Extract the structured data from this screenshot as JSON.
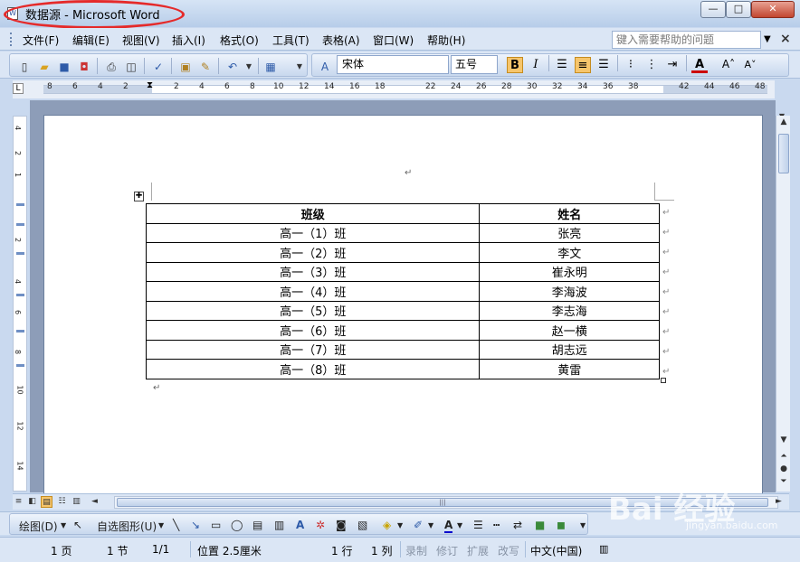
{
  "window": {
    "title": "数据源 - Microsoft Word",
    "min_glyph": "—",
    "max_glyph": "□",
    "close_glyph": "✕"
  },
  "menubar": {
    "items": [
      "文件(F)",
      "编辑(E)",
      "视图(V)",
      "插入(I)",
      "格式(O)",
      "工具(T)",
      "表格(A)",
      "窗口(W)",
      "帮助(H)"
    ],
    "help_placeholder": "键入需要帮助的问题",
    "close_doc": "×"
  },
  "toolbar": {
    "font_name": "宋体",
    "font_size": "五号",
    "bold_label": "B",
    "italic_label": "I",
    "font_color_label": "A",
    "grow_label": "A˄",
    "shrink_label": "A˅",
    "accent": "#f6c56b"
  },
  "ruler": {
    "marks": [
      "8",
      "6",
      "4",
      "2",
      "2",
      "4",
      "6",
      "8",
      "10",
      "12",
      "14",
      "16",
      "18",
      "22",
      "24",
      "26",
      "28",
      "30",
      "32",
      "34",
      "36",
      "38",
      "42",
      "44",
      "46",
      "48"
    ]
  },
  "vruler": {
    "marks": [
      "4",
      "2",
      "1",
      "2",
      "4",
      "6",
      "8",
      "10",
      "12",
      "14"
    ]
  },
  "document": {
    "table": {
      "headers": [
        "班级",
        "姓名"
      ],
      "rows": [
        [
          "高一（1）班",
          "张亮"
        ],
        [
          "高一（2）班",
          "李文"
        ],
        [
          "高一（3）班",
          "崔永明"
        ],
        [
          "高一（4）班",
          "李海波"
        ],
        [
          "高一（5）班",
          "李志海"
        ],
        [
          "高一（6）班",
          "赵一横"
        ],
        [
          "高一（7）班",
          "胡志远"
        ],
        [
          "高一（8）班",
          "黄雷"
        ]
      ]
    },
    "para_mark": "↵",
    "cell_mark": "↵"
  },
  "drawbar": {
    "draw_label": "绘图(D)",
    "autoshape_label": "自选图形(U)"
  },
  "status": {
    "page": "1 页",
    "section": "1 节",
    "page_of": "1/1",
    "position": "位置 2.5厘米",
    "line": "1 行",
    "col": "1 列",
    "rec": "录制",
    "trk": "修订",
    "ext": "扩展",
    "ovr": "改写",
    "lang": "中文(中国)"
  },
  "watermark": {
    "text": "Bai 经验",
    "url": "jingyan.baidu.com"
  }
}
